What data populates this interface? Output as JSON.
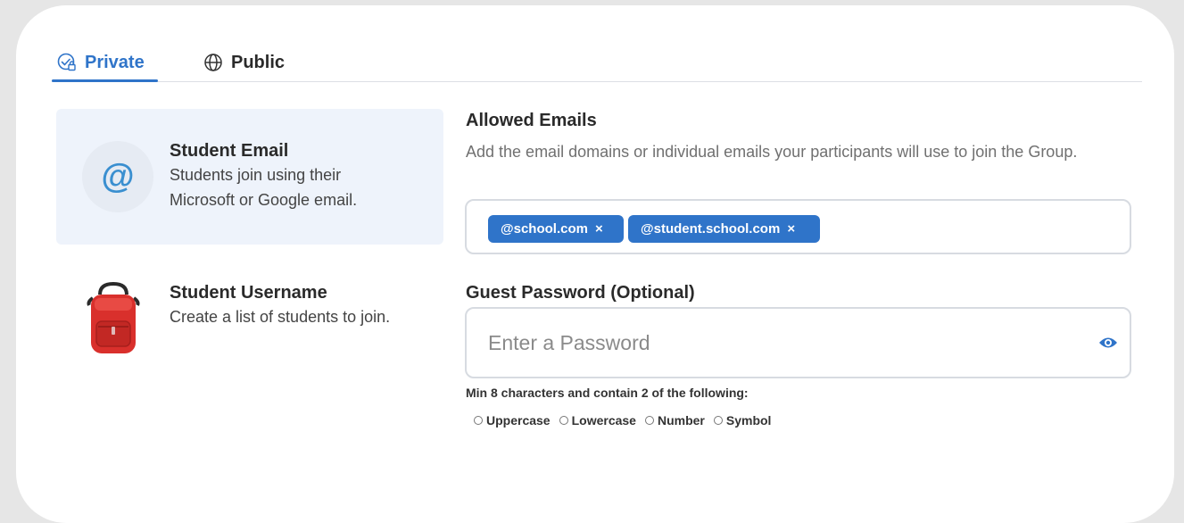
{
  "tabs": {
    "private_label": "Private",
    "public_label": "Public",
    "active": "private"
  },
  "options": {
    "email": {
      "title": "Student Email",
      "description": "Students join using their Microsoft or Google email.",
      "icon": "at-sign-icon",
      "selected": true
    },
    "username": {
      "title": "Student Username",
      "description": "Create a list of students to join.",
      "icon": "backpack-icon"
    }
  },
  "allowed_emails": {
    "title": "Allowed Emails",
    "description": "Add the email domains or individual emails your participants will use to join the Group.",
    "chips": [
      "@school.com",
      "@student.school.com"
    ],
    "remove_glyph": "×"
  },
  "guest_password": {
    "title": "Guest Password (Optional)",
    "placeholder": "Enter a Password",
    "value": "",
    "rules_text": "Min 8 characters and contain 2 of the following:",
    "requirements": [
      "Uppercase",
      "Lowercase",
      "Number",
      "Symbol"
    ]
  },
  "colors": {
    "accent": "#2f74c9",
    "selected_bg": "#eef3fb",
    "backpack": "#d9302c"
  }
}
